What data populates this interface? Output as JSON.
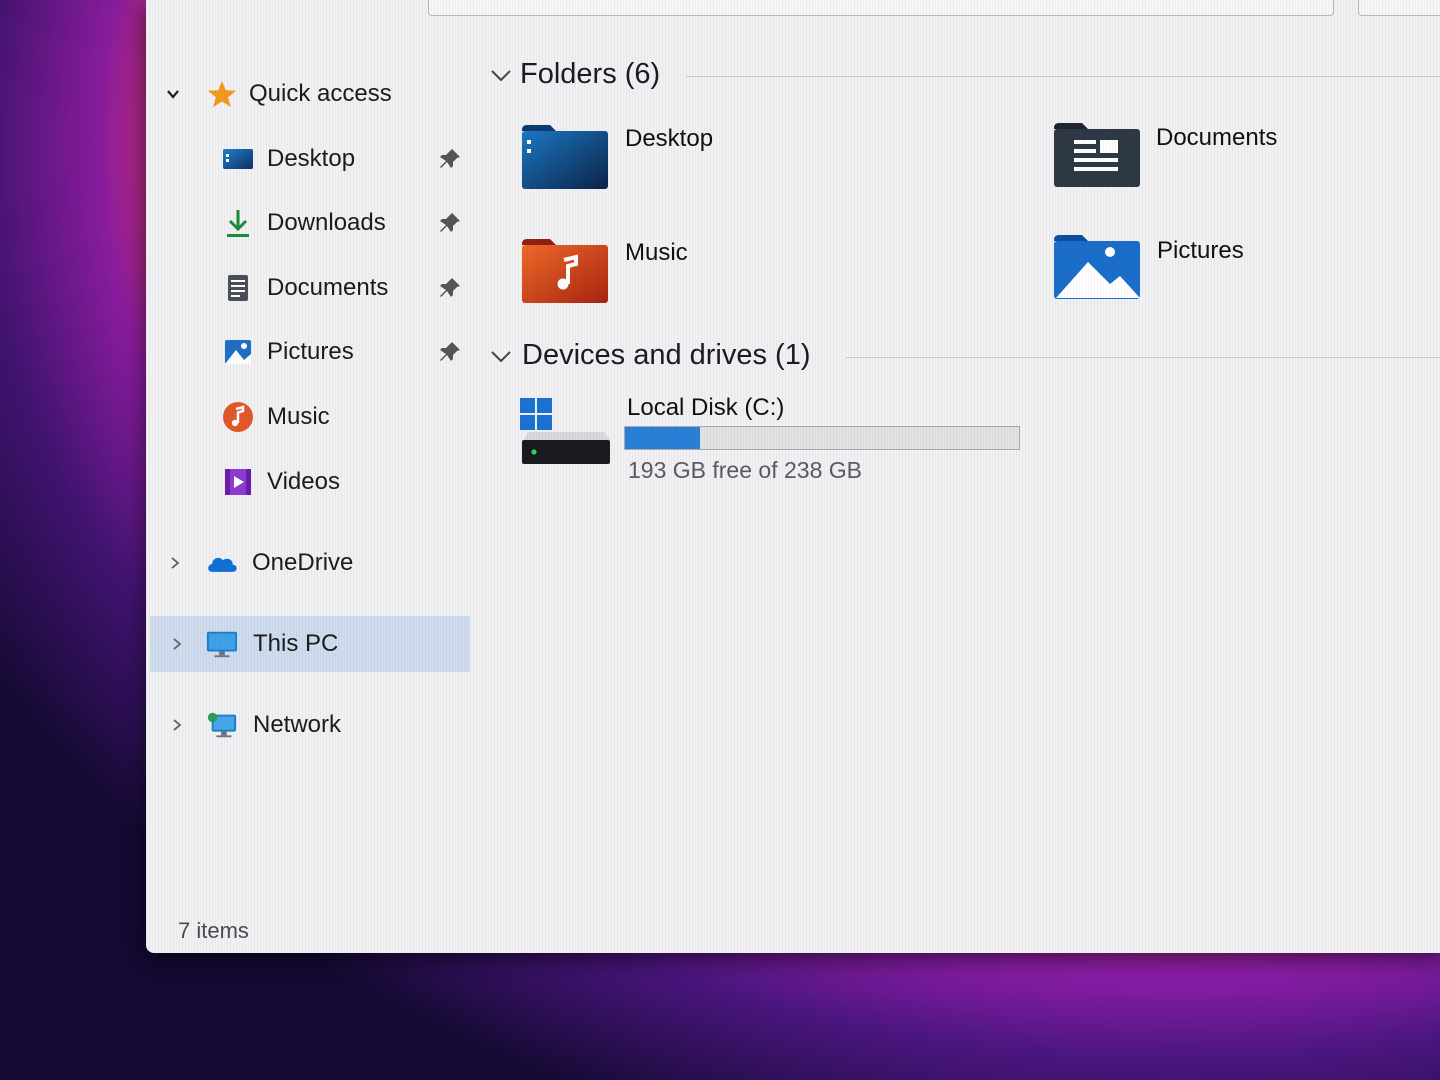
{
  "nav": {
    "quick_access": "Quick access",
    "items": [
      {
        "label": "Desktop",
        "pinned": true
      },
      {
        "label": "Downloads",
        "pinned": true
      },
      {
        "label": "Documents",
        "pinned": true
      },
      {
        "label": "Pictures",
        "pinned": true
      },
      {
        "label": "Music",
        "pinned": false
      },
      {
        "label": "Videos",
        "pinned": false
      }
    ],
    "onedrive": "OneDrive",
    "this_pc": "This PC",
    "network": "Network"
  },
  "content": {
    "folders_header": "Folders (6)",
    "folders": [
      {
        "name": "Desktop",
        "icon": "desktop-folder-icon"
      },
      {
        "name": "Documents",
        "icon": "documents-folder-icon"
      },
      {
        "name": "Music",
        "icon": "music-folder-icon"
      },
      {
        "name": "Pictures",
        "icon": "pictures-folder-icon"
      }
    ],
    "devices_header": "Devices and drives (1)",
    "drive": {
      "name": "Local Disk (C:)",
      "free_text": "193 GB free of 238 GB",
      "used_fraction": 0.19
    }
  },
  "status": {
    "items": "7 items"
  },
  "colors": {
    "selection": "#cfdcee",
    "accent": "#2a7fd8",
    "quick_access_star": "#f39a1e"
  }
}
